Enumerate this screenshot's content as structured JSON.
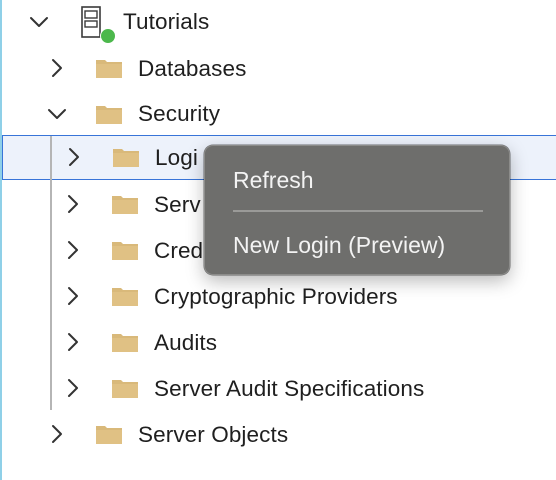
{
  "tree": {
    "server": {
      "label": "Tutorials",
      "status_color": "#4cb84c"
    },
    "databases": {
      "label": "Databases"
    },
    "security": {
      "label": "Security"
    },
    "logins": {
      "label": "Logins",
      "visible_label": "Logi"
    },
    "server_roles": {
      "label": "Server Roles",
      "visible_label": "Serv"
    },
    "credentials": {
      "label": "Credentials",
      "visible_label": "Cred"
    },
    "crypto": {
      "label": "Cryptographic Providers"
    },
    "audits": {
      "label": "Audits"
    },
    "audit_specs": {
      "label": "Server Audit Specifications"
    },
    "server_objects": {
      "label": "Server Objects"
    }
  },
  "context_menu": {
    "refresh": "Refresh",
    "new_login": "New Login (Preview)"
  },
  "colors": {
    "folder": "#d9b97a",
    "selection_border": "#3874d8",
    "menu_bg": "#6e6e6c"
  }
}
